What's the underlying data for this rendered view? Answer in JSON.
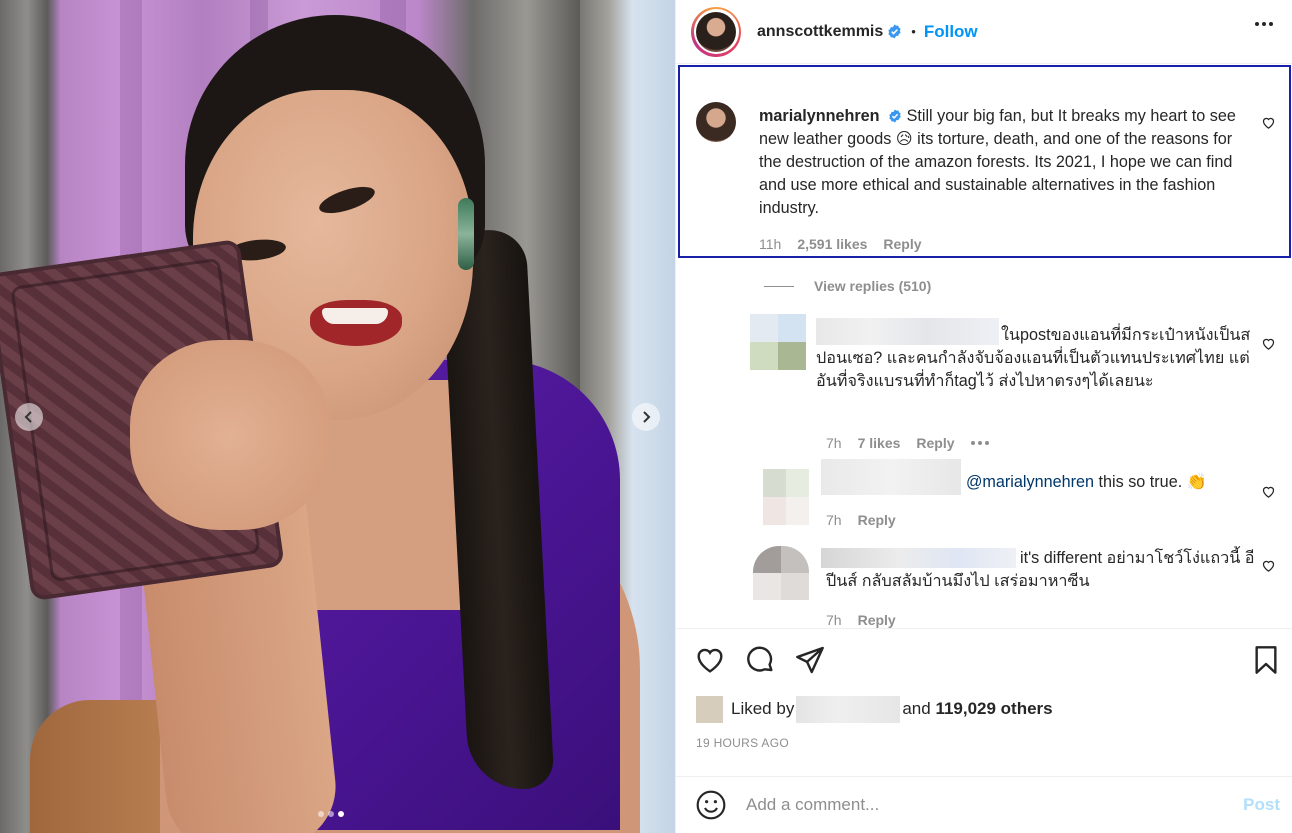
{
  "post": {
    "author": "annscottkemmis",
    "follow_label": "Follow",
    "separator": "•"
  },
  "carousel": {
    "slide_count": 3,
    "active_index": 2
  },
  "highlighted_comment": {
    "username": "marialynnehren",
    "text": "Still your big fan, but It breaks my heart to see new leather goods 😥 its torture, death, and one of the reasons for the destruction of the amazon forests. Its 2021, I hope we can find and use more ethical and sustainable alternatives in the fashion industry.",
    "time": "11h",
    "likes": "2,591 likes",
    "reply_label": "Reply",
    "view_replies": "View replies (510)"
  },
  "replies": [
    {
      "text": "ในpostของแอนที่มีกระเป๋าหนังเป็นสปอนเซอ? และคนกำลังจับจ้องแอนที่เป็นตัวแทนประเทศไทย แต่อันที่จริงแบรนที่ทำก็tagไว้ ส่งไปหาตรงๆได้เลยนะ",
      "time": "7h",
      "likes": "7 likes",
      "reply_label": "Reply"
    },
    {
      "mention": "@marialynnehren",
      "text": "this so true. 👏",
      "time": "7h",
      "reply_label": "Reply"
    },
    {
      "text": "it's different อย่ามาโชว์โง่แถวนี้ อีปีนส์ กลับสลัมบ้านมึงไป เสร่อมาหาซีน",
      "time": "7h",
      "reply_label": "Reply"
    }
  ],
  "likes_summary": {
    "prefix": "Liked by",
    "joiner": "and",
    "count_text": "119,029 others"
  },
  "timestamp": "19 HOURS AGO",
  "comment_input": {
    "placeholder": "Add a comment...",
    "post_label": "Post"
  },
  "icons": [
    "heart-icon",
    "comment-icon",
    "share-icon",
    "bookmark-icon",
    "emoji-icon",
    "verified-icon",
    "more-icon"
  ],
  "colors": {
    "accent": "#0095f6",
    "highlight_border": "#1722a8",
    "verified": "#3897f0"
  }
}
